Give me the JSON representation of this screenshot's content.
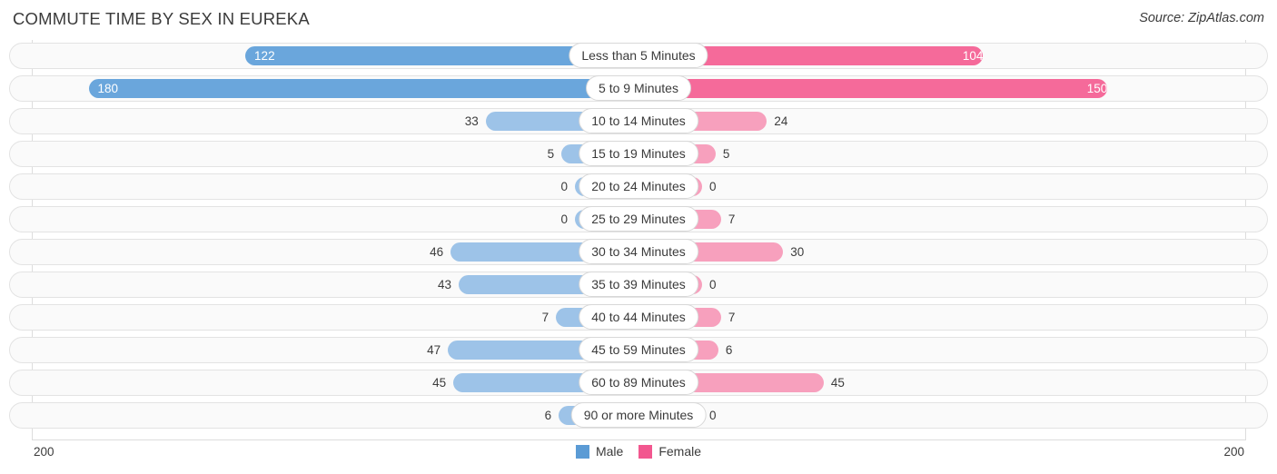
{
  "header": {
    "title": "COMMUTE TIME BY SEX IN EUREKA",
    "source": "Source: ZipAtlas.com"
  },
  "legend": {
    "male_label": "Male",
    "female_label": "Female",
    "male_color": "#5b9bd5",
    "female_color": "#f2578f"
  },
  "axis": {
    "left_tick": "200",
    "right_tick": "200",
    "max": 200
  },
  "colors": {
    "male_strong": "#6aa6dc",
    "male_light": "#9dc3e8",
    "female_strong": "#f56a9a",
    "female_light": "#f7a0bd",
    "track_bg": "#fafafa",
    "track_border": "#e3e3e3",
    "gridline": "#dddddd",
    "text": "#3c3c3c"
  },
  "chart_data": {
    "type": "bar",
    "orientation": "horizontal-diverging",
    "title": "COMMUTE TIME BY SEX IN EUREKA",
    "xlabel": "",
    "ylabel": "",
    "xlim": [
      200,
      200
    ],
    "grid": true,
    "legend_position": "bottom-center",
    "categories": [
      "Less than 5 Minutes",
      "5 to 9 Minutes",
      "10 to 14 Minutes",
      "15 to 19 Minutes",
      "20 to 24 Minutes",
      "25 to 29 Minutes",
      "30 to 34 Minutes",
      "35 to 39 Minutes",
      "40 to 44 Minutes",
      "45 to 59 Minutes",
      "60 to 89 Minutes",
      "90 or more Minutes"
    ],
    "series": [
      {
        "name": "Male",
        "values": [
          122,
          180,
          33,
          5,
          0,
          0,
          46,
          43,
          7,
          47,
          45,
          6
        ]
      },
      {
        "name": "Female",
        "values": [
          104,
          150,
          24,
          5,
          0,
          7,
          30,
          0,
          7,
          6,
          45,
          0
        ]
      }
    ]
  },
  "rows": [
    {
      "label": "Less than 5 Minutes",
      "male": "122",
      "female": "104"
    },
    {
      "label": "5 to 9 Minutes",
      "male": "180",
      "female": "150"
    },
    {
      "label": "10 to 14 Minutes",
      "male": "33",
      "female": "24"
    },
    {
      "label": "15 to 19 Minutes",
      "male": "5",
      "female": "5"
    },
    {
      "label": "20 to 24 Minutes",
      "male": "0",
      "female": "0"
    },
    {
      "label": "25 to 29 Minutes",
      "male": "0",
      "female": "7"
    },
    {
      "label": "30 to 34 Minutes",
      "male": "46",
      "female": "30"
    },
    {
      "label": "35 to 39 Minutes",
      "male": "43",
      "female": "0"
    },
    {
      "label": "40 to 44 Minutes",
      "male": "7",
      "female": "7"
    },
    {
      "label": "45 to 59 Minutes",
      "male": "47",
      "female": "6"
    },
    {
      "label": "60 to 89 Minutes",
      "male": "45",
      "female": "45"
    },
    {
      "label": "90 or more Minutes",
      "male": "6",
      "female": "0"
    }
  ]
}
